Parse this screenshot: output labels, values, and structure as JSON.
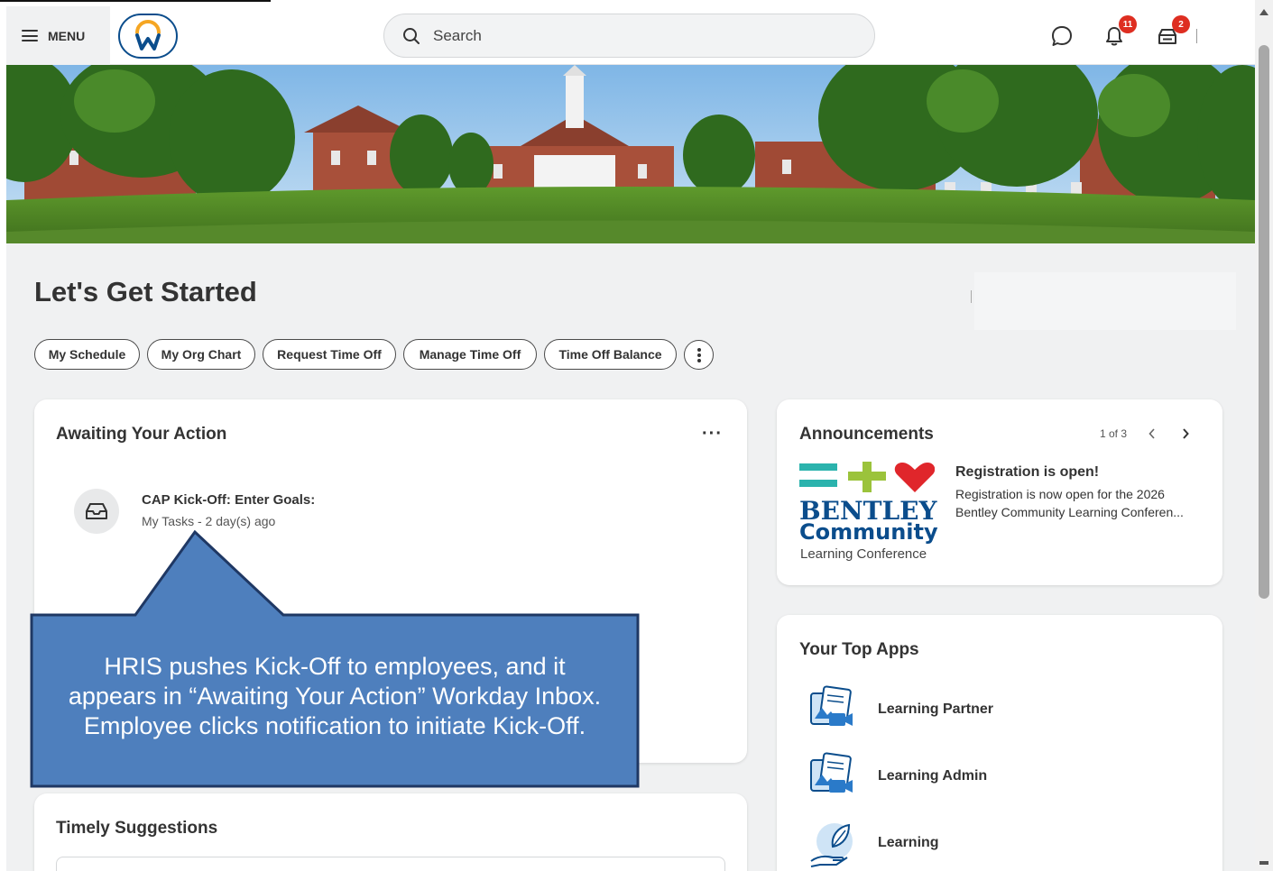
{
  "header": {
    "menu_label": "MENU",
    "search_placeholder": "Search",
    "notifications_count": "11",
    "inbox_count": "2"
  },
  "page": {
    "title": "Let's Get Started"
  },
  "quick_actions": [
    {
      "label": "My Schedule"
    },
    {
      "label": "My Org Chart"
    },
    {
      "label": "Request Time Off"
    },
    {
      "label": "Manage Time Off"
    },
    {
      "label": "Time Off Balance"
    }
  ],
  "awaiting": {
    "title": "Awaiting Your Action",
    "task_title": "CAP Kick-Off: Enter Goals:",
    "task_meta": "My Tasks - 2 day(s) ago"
  },
  "announcements": {
    "title": "Announcements",
    "pager": "1 of 3",
    "item_title": "Registration is open!",
    "item_body": "Registration is now open for the 2026 Bentley Community Learning Conferen...",
    "logo_line1": "BENTLEY",
    "logo_line2": "Community",
    "logo_line3": "Learning Conference"
  },
  "top_apps": {
    "title": "Your Top Apps",
    "apps": [
      {
        "label": "Learning Partner"
      },
      {
        "label": "Learning Admin"
      },
      {
        "label": "Learning"
      }
    ]
  },
  "timely": {
    "title": "Timely Suggestions"
  },
  "callout": {
    "text": "HRIS pushes Kick-Off to employees, and it appears in “Awaiting Your Action” Workday Inbox. Employee clicks notification to initiate Kick-Off."
  },
  "colors": {
    "brand_blue": "#0b4d8c",
    "workday_orange": "#f5a623",
    "badge_red": "#de2e21",
    "callout_fill": "#4e7fbd",
    "callout_border": "#1f3864"
  }
}
